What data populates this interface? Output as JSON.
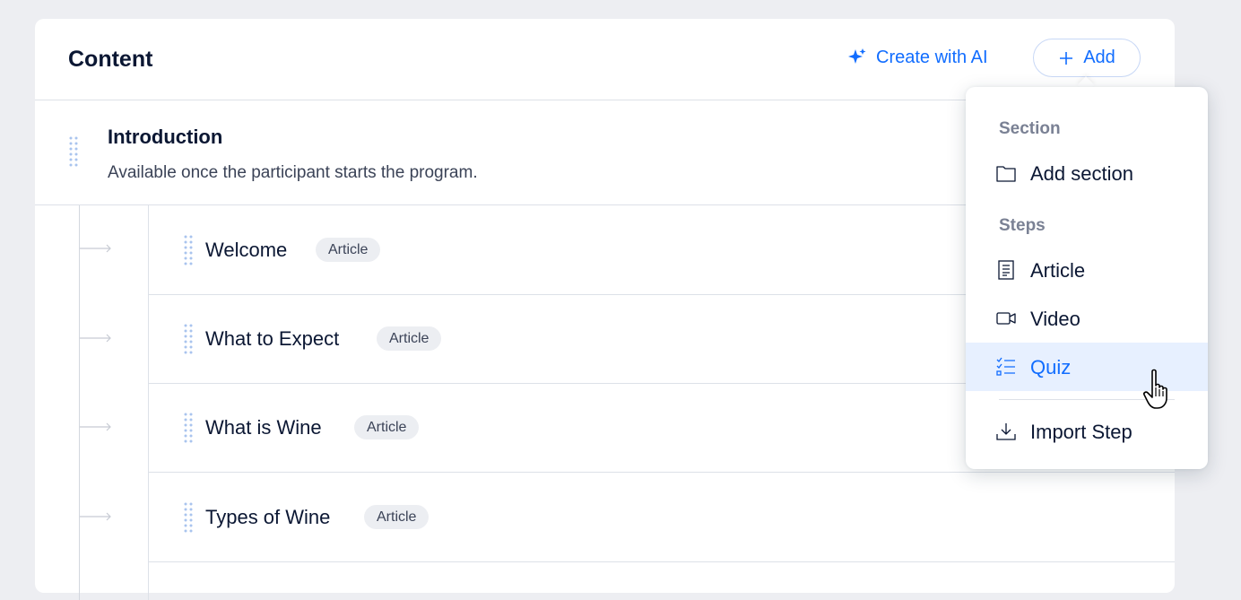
{
  "header": {
    "title": "Content",
    "create_ai_label": "Create with AI",
    "add_label": "Add"
  },
  "intro": {
    "title": "Introduction",
    "description": "Available once the participant starts the program."
  },
  "steps": [
    {
      "title": "Welcome",
      "type": "Article"
    },
    {
      "title": "What to Expect",
      "type": "Article"
    },
    {
      "title": "What is Wine",
      "type": "Article"
    },
    {
      "title": "Types of Wine",
      "type": "Article"
    }
  ],
  "menu": {
    "section_heading": "Section",
    "add_section_label": "Add section",
    "steps_heading": "Steps",
    "article_label": "Article",
    "video_label": "Video",
    "quiz_label": "Quiz",
    "import_label": "Import Step"
  },
  "colors": {
    "accent": "#116DFF",
    "highlight": "#E7F0FF",
    "background": "#EDEEF2"
  }
}
